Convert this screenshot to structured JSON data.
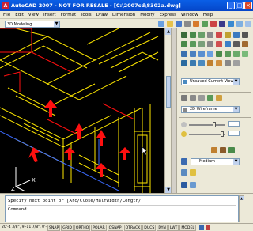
{
  "window": {
    "title": "AutoCAD 2007 - NOT FOR RESALE - [C:\\2007cd\\8302a.dwg]"
  },
  "menu": [
    "File",
    "Edit",
    "View",
    "Insert",
    "Format",
    "Tools",
    "Draw",
    "Dimension",
    "Modify",
    "Express",
    "Window",
    "Help"
  ],
  "toolbar": {
    "workspace": "3D Modeling"
  },
  "dashboard": {
    "view_combo": "Unsaved Current View",
    "visual_style_combo": "2D Wireframe",
    "material_combo": "Medium"
  },
  "command": {
    "lines": [
      "Specify next point or [Arc/Close/Halfwidth/Length/",
      "",
      "Command:"
    ]
  },
  "status": {
    "coords": "20'-4 3/8\",  9'-11 7/8\",  0'-0\"",
    "buttons": [
      "SNAP",
      "GRID",
      "ORTHO",
      "POLAR",
      "OSNAP",
      "OTRACK",
      "DUCS",
      "DYN",
      "LWT",
      "MODEL"
    ]
  },
  "ucs": {
    "x_label": "X",
    "z_label": "Z"
  },
  "colors": {
    "title_bar": "#0a5fe6",
    "canvas": "#000000",
    "wall_yellow": "#ffe800",
    "arrow_red": "#ff1010",
    "edge_blue": "#3b6bff"
  }
}
